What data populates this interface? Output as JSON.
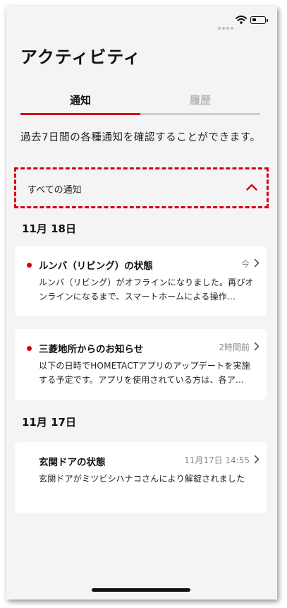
{
  "header": {
    "title": "アクティビティ"
  },
  "tabs": [
    {
      "label": "通知"
    },
    {
      "label": "履歴"
    }
  ],
  "description": "過去7日間の各種通知を確認することができます。",
  "filter": {
    "label": "すべての通知"
  },
  "groups": [
    {
      "date": "11月 18日",
      "items": [
        {
          "title": "ルンバ（リビング）の状態",
          "time": "今",
          "unread": true,
          "body": "ルンバ（リビング）がオフラインになりました。再びオンラインになるまで、スマートホームによる操作..."
        },
        {
          "title": "三菱地所からのお知らせ",
          "time": "2時間前",
          "unread": true,
          "body": "以下の日時でHOMETACTアプリのアップデートを実施する予定です。アプリを使用されている方は、各ア..."
        }
      ]
    },
    {
      "date": "11月 17日",
      "items": [
        {
          "title": "玄関ドアの状態",
          "time": "11月17日 14:55",
          "unread": false,
          "body": "玄関ドアがミツビシハナコさんにより解錠されました"
        }
      ]
    }
  ],
  "colors": {
    "accent": "#d7000f",
    "background": "#f4f4f4",
    "card": "#ffffff"
  },
  "icons": {
    "filter_toggle": "chevron-up-icon",
    "row_arrow": "chevron-right-icon"
  }
}
